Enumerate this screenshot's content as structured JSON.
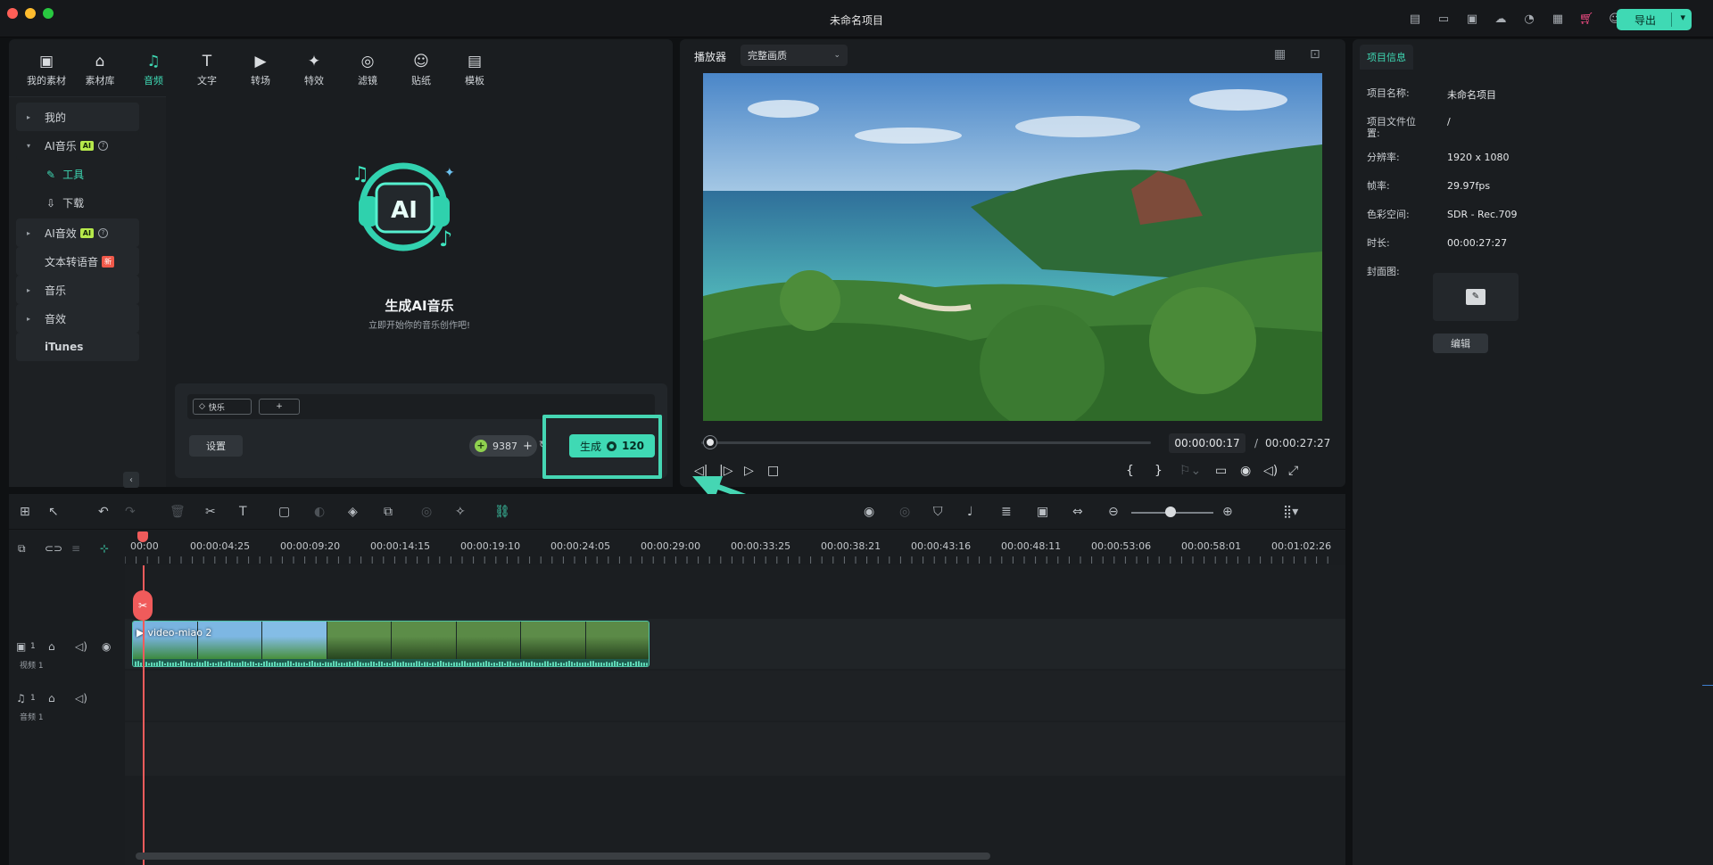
{
  "window": {
    "title": "未命名项目"
  },
  "header": {
    "export_label": "导出"
  },
  "media_tabs": [
    {
      "label": "我的素材",
      "icon": "my-media-icon",
      "glyph": "▣"
    },
    {
      "label": "素材库",
      "icon": "stock-media-icon",
      "glyph": "⌂"
    },
    {
      "label": "音频",
      "icon": "audio-icon",
      "glyph": "♫"
    },
    {
      "label": "文字",
      "icon": "text-icon",
      "glyph": "T"
    },
    {
      "label": "转场",
      "icon": "transition-icon",
      "glyph": "▶"
    },
    {
      "label": "特效",
      "icon": "effects-icon",
      "glyph": "✦"
    },
    {
      "label": "滤镜",
      "icon": "filter-icon",
      "glyph": "◎"
    },
    {
      "label": "贴纸",
      "icon": "sticker-icon",
      "glyph": "☺"
    },
    {
      "label": "模板",
      "icon": "template-icon",
      "glyph": "▤"
    }
  ],
  "sidebar": {
    "items": [
      {
        "label": "我的"
      },
      {
        "label": "AI音乐",
        "badge": "AI"
      },
      {
        "label": "AI音效",
        "badge": "AI"
      },
      {
        "label": "文本转语音",
        "badge": "新"
      },
      {
        "label": "音乐"
      },
      {
        "label": "音效"
      },
      {
        "label": "iTunes"
      }
    ],
    "sub_items": [
      {
        "label": "工具"
      },
      {
        "label": "下载"
      }
    ]
  },
  "ai_music": {
    "hero_text": "AI",
    "title": "生成AI音乐",
    "subtitle": "立即开始你的音乐创作吧!",
    "chip_label": "快乐",
    "add_chip": "+",
    "settings_label": "设置",
    "credits": "9387",
    "credits_plus": "+",
    "generate_label": "生成",
    "generate_cost": "120"
  },
  "player": {
    "label": "播放器",
    "quality": "完整画质",
    "current_time": "00:00:00:17",
    "separator": "/",
    "total_time": "00:00:27:27",
    "progress": 0.005
  },
  "project_info": {
    "tab": "项目信息",
    "rows": [
      {
        "key": "项目名称:",
        "value": "未命名项目"
      },
      {
        "key": "项目文件位置:",
        "value": "/"
      },
      {
        "key": "分辨率:",
        "value": "1920 x 1080"
      },
      {
        "key": "帧率:",
        "value": "29.97fps"
      },
      {
        "key": "色彩空间:",
        "value": "SDR - Rec.709"
      },
      {
        "key": "时长:",
        "value": "00:00:27:27"
      },
      {
        "key": "封面图:",
        "value": ""
      }
    ],
    "edit_label": "编辑"
  },
  "timeline": {
    "ruler": [
      "00:00",
      "00:00:04:25",
      "00:00:09:20",
      "00:00:14:15",
      "00:00:19:10",
      "00:00:24:05",
      "00:00:29:00",
      "00:00:33:25",
      "00:00:38:21",
      "00:00:43:16",
      "00:00:48:11",
      "00:00:53:06",
      "00:00:58:01",
      "00:01:02:26"
    ],
    "video_track": {
      "index": "1",
      "label": "视频 1"
    },
    "audio_track": {
      "index": "1",
      "label": "音频 1"
    },
    "clip_name": "video-miao 2"
  },
  "colors": {
    "accent": "#3fd9b4",
    "playhead": "#f05b5b",
    "ai_badge": "#b6e94b",
    "new_badge": "#f0594a"
  }
}
